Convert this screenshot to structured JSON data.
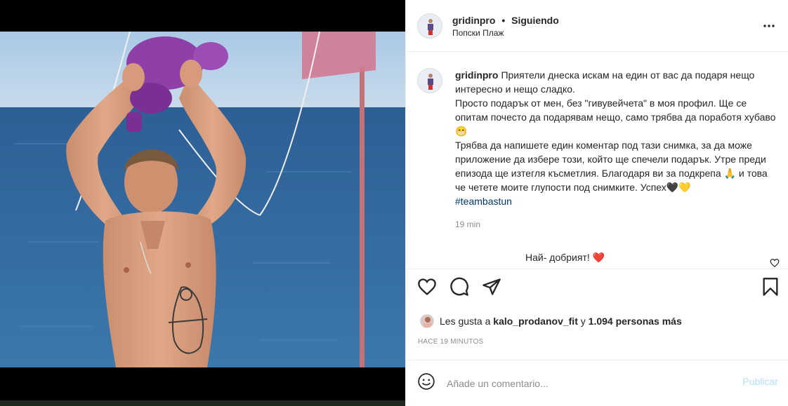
{
  "post": {
    "username": "gridinpro",
    "follow_status": "Siguiendo",
    "location": "Попски Плаж"
  },
  "caption": {
    "username": "gridinpro",
    "lines": [
      "Приятели днеска искам на един от вас да подаря нещо интересно и нещо сладко.",
      "Просто подарък от мен, без \"гивувейчета\" в моя профил. Ще се опитам почесто да подарявам нещо, само трябва да поработя хубаво 😁",
      "Трябва да напишете един коментар под тази снимка, за да може приложение да избере този, който ще спечели подарък. Утре преди епизода ще изтегля късметлия. Благодаря ви за подкрепа 🙏 и това че четете моите глупости под снимките. Успех🖤💛"
    ],
    "hashtag": "#teambastun",
    "time": "19 min"
  },
  "reply": {
    "text": "Най- добрият!",
    "emoji": "❤️"
  },
  "likes": {
    "prefix": "Les gusta a",
    "user": "kalo_prodanov_fit",
    "connector": "y",
    "count_text": "1.094 personas más"
  },
  "posted_ago": "HACE 19 MINUTOS",
  "comment_input": {
    "placeholder": "Añade un comentario...",
    "publish_label": "Publicar"
  },
  "icons": {
    "more": "more-options-icon",
    "like": "heart-icon",
    "comment": "comment-icon",
    "share": "share-icon",
    "save": "bookmark-icon",
    "emoji": "emoji-icon"
  },
  "colors": {
    "link": "#00376b",
    "publish_disabled": "#b2dffc",
    "meta_gray": "#8e8e8e"
  }
}
